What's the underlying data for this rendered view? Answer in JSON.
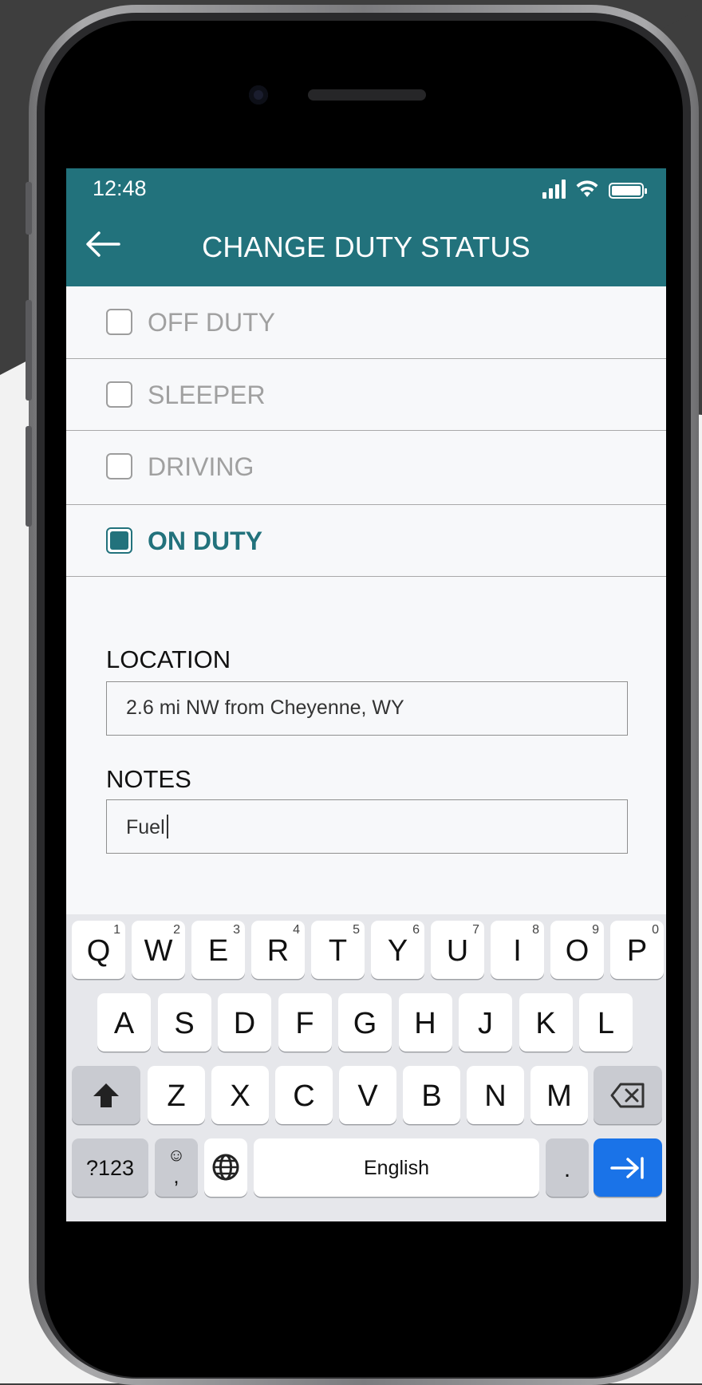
{
  "status_bar": {
    "time": "12:48"
  },
  "header": {
    "title": "CHANGE DUTY STATUS"
  },
  "duty_statuses": [
    {
      "label": "OFF DUTY",
      "checked": false
    },
    {
      "label": "SLEEPER",
      "checked": false
    },
    {
      "label": "DRIVING",
      "checked": false
    },
    {
      "label": "ON DUTY",
      "checked": true
    }
  ],
  "location": {
    "label": "LOCATION",
    "value": "2.6 mi NW from Cheyenne, WY"
  },
  "notes": {
    "label": "NOTES",
    "value": "Fuel"
  },
  "keyboard": {
    "row1": [
      {
        "k": "Q",
        "sup": "1"
      },
      {
        "k": "W",
        "sup": "2"
      },
      {
        "k": "E",
        "sup": "3"
      },
      {
        "k": "R",
        "sup": "4"
      },
      {
        "k": "T",
        "sup": "5"
      },
      {
        "k": "Y",
        "sup": "6"
      },
      {
        "k": "U",
        "sup": "7"
      },
      {
        "k": "I",
        "sup": "8"
      },
      {
        "k": "O",
        "sup": "9"
      },
      {
        "k": "P",
        "sup": "0"
      }
    ],
    "row2": [
      "A",
      "S",
      "D",
      "F",
      "G",
      "H",
      "J",
      "K",
      "L"
    ],
    "row3": [
      "Z",
      "X",
      "C",
      "V",
      "B",
      "N",
      "M"
    ],
    "symbols_label": "?123",
    "emoji_glyph": "☺",
    "comma_label": ",",
    "space_label": "English",
    "period_label": ".",
    "icons": {
      "shift": "shift-icon",
      "backspace": "backspace-icon",
      "globe": "globe-icon",
      "next": "next-field-icon"
    }
  },
  "colors": {
    "accent": "#22727c",
    "enter_key": "#1a73e8"
  }
}
